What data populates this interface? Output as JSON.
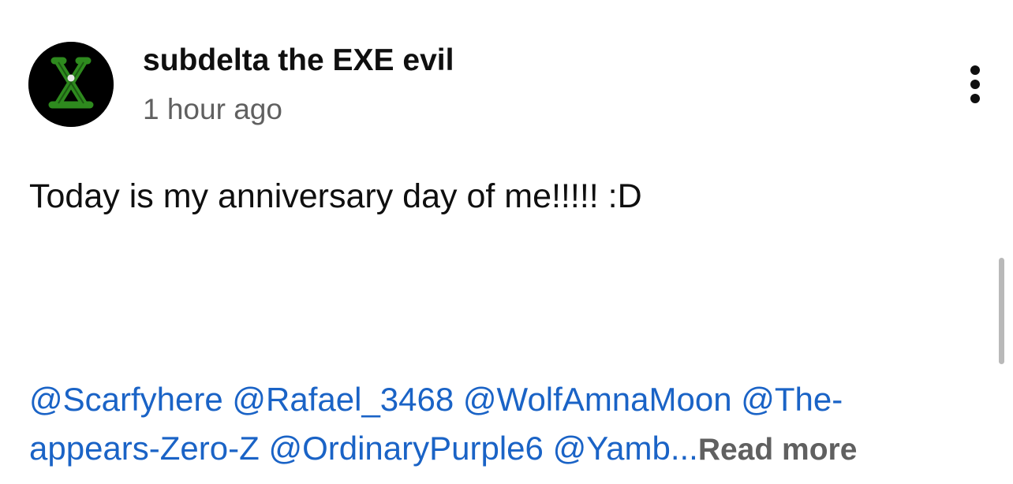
{
  "post": {
    "author": "subdelta the EXE evil",
    "timestamp": "1 hour ago",
    "text": "Today is my anniversary day of me!!!!! :D",
    "mentions_line1": [
      "@Scarfyhere",
      "@Rafael_3468",
      "@WolfAmnaMoon",
      "@The-"
    ],
    "mentions_line2": [
      "appears-Zero-Z",
      "@OrdinaryPurple6",
      "@Yamb"
    ],
    "ellipsis": "...",
    "read_more": "Read more"
  },
  "icons": {
    "avatar": "avatar-image",
    "menu": "more-vert-icon"
  },
  "colors": {
    "link": "#1a63c6",
    "secondary_text": "#606060",
    "primary_text": "#0f0f0f",
    "avatar_bg": "#000000",
    "avatar_symbol": "#2e8a1e"
  }
}
